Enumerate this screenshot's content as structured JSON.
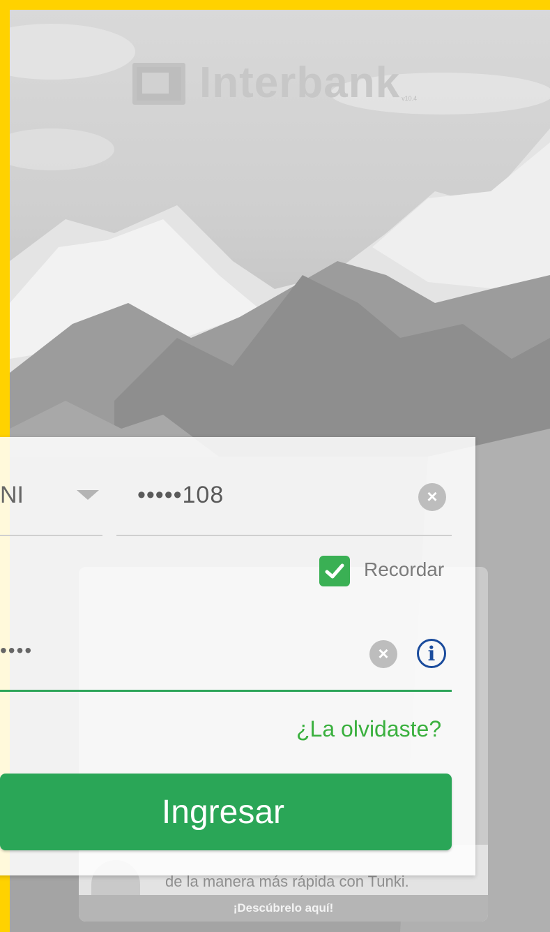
{
  "brand": {
    "name": "Interbank",
    "version": "v10.4"
  },
  "login": {
    "doc_type": "NI",
    "doc_number": "•••••108",
    "remember_label": "Recordar",
    "password_value": "••••",
    "forgot_label": "¿La olvidaste?",
    "submit_label": "Ingresar"
  },
  "promo": {
    "text": "de la manera más rápida con Tunki.",
    "cta": "¡Descúbrelo aquí!"
  },
  "colors": {
    "frame": "#ffd200",
    "primary_green": "#2aa657",
    "link_green": "#3ab03e",
    "info_blue": "#1a4b9c"
  },
  "icons": {
    "dropdown": "caret-down-icon",
    "clear": "close-circle-icon",
    "checkbox": "checkmark-icon",
    "info": "info-icon"
  }
}
